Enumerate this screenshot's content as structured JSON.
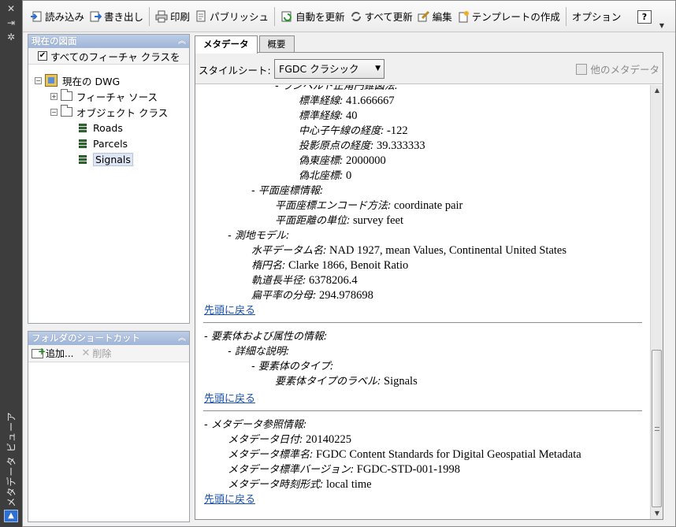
{
  "window": {
    "title": "メタデータ ビューア"
  },
  "toolbar": {
    "items": [
      {
        "label": "読み込み",
        "icon": "import-icon"
      },
      {
        "label": "書き出し",
        "icon": "export-icon"
      },
      {
        "label": "印刷",
        "icon": "print-icon"
      },
      {
        "label": "パブリッシュ",
        "icon": "publish-icon"
      },
      {
        "label": "自動を更新",
        "icon": "auto-update-icon"
      },
      {
        "label": "すべて更新",
        "icon": "update-all-icon"
      },
      {
        "label": "編集",
        "icon": "edit-icon"
      },
      {
        "label": "テンプレートの作成",
        "icon": "create-template-icon"
      },
      {
        "label": "オプション",
        "icon": ""
      }
    ],
    "help_label": "?"
  },
  "current_drawing": {
    "header": "現在の図面",
    "all_feature_classes": {
      "label": "すべてのフィーチャ クラスを",
      "checked": true
    },
    "tree": {
      "root": "現在の DWG",
      "feature_source": "フィーチャ ソース",
      "object_class": "オブジェクト クラス",
      "layers": [
        "Roads",
        "Parcels",
        "Signals"
      ],
      "selected": "Signals"
    }
  },
  "folder_shortcuts": {
    "header": "フォルダのショートカット",
    "add_label": "追加...",
    "delete_label": "削除"
  },
  "tabs": {
    "metadata": "メタデータ",
    "summary": "概要"
  },
  "stylesheet": {
    "label": "スタイルシート:",
    "value": "FGDC クラシック",
    "other_metadata": "他のメタデータ"
  },
  "content": {
    "lines": [
      {
        "indent": 3,
        "key": "- ランベルト正角円錐図法:",
        "value": ""
      },
      {
        "indent": 4,
        "key": "標準経線:",
        "value": " 41.666667"
      },
      {
        "indent": 4,
        "key": "標準経線:",
        "value": " 40"
      },
      {
        "indent": 4,
        "key": "中心子午線の経度:",
        "value": " -122"
      },
      {
        "indent": 4,
        "key": "投影原点の経度:",
        "value": " 39.333333"
      },
      {
        "indent": 4,
        "key": "偽東座標:",
        "value": " 2000000"
      },
      {
        "indent": 4,
        "key": "偽北座標:",
        "value": " 0"
      },
      {
        "indent": 2,
        "key": "- 平面座標情報:",
        "value": ""
      },
      {
        "indent": 3,
        "key": "平面座標エンコード方法:",
        "value": " coordinate pair"
      },
      {
        "indent": 3,
        "key": "平面距離の単位:",
        "value": " survey feet"
      },
      {
        "indent": 1,
        "key": "- 測地モデル:",
        "value": ""
      },
      {
        "indent": 2,
        "key": "水平データム名:",
        "value": " NAD 1927, mean Values, Continental United States"
      },
      {
        "indent": 2,
        "key": "楕円名:",
        "value": " Clarke 1866, Benoit Ratio"
      },
      {
        "indent": 2,
        "key": "軌道長半径:",
        "value": " 6378206.4"
      },
      {
        "indent": 2,
        "key": "扁平率の分母:",
        "value": " 294.978698"
      }
    ],
    "back_to_top": "先頭に戻る",
    "section2": [
      {
        "indent": 0,
        "key": "- 要素体および属性の情報:",
        "value": ""
      },
      {
        "indent": 1,
        "key": "- 詳細な説明:",
        "value": ""
      },
      {
        "indent": 2,
        "key": "- 要素体のタイプ:",
        "value": ""
      },
      {
        "indent": 3,
        "key": "要素体タイプのラベル:",
        "value": " Signals"
      }
    ],
    "section3": [
      {
        "indent": 0,
        "key": "- メタデータ参照情報:",
        "value": ""
      },
      {
        "indent": 1,
        "key": "メタデータ日付:",
        "value": " 20140225"
      },
      {
        "indent": 1,
        "key": "メタデータ標準名:",
        "value": " FGDC Content Standards for Digital Geospatial Metadata"
      },
      {
        "indent": 1,
        "key": "メタデータ標準バージョン:",
        "value": " FGDC-STD-001-1998"
      },
      {
        "indent": 1,
        "key": "メタデータ時刻形式:",
        "value": " local time"
      }
    ]
  }
}
